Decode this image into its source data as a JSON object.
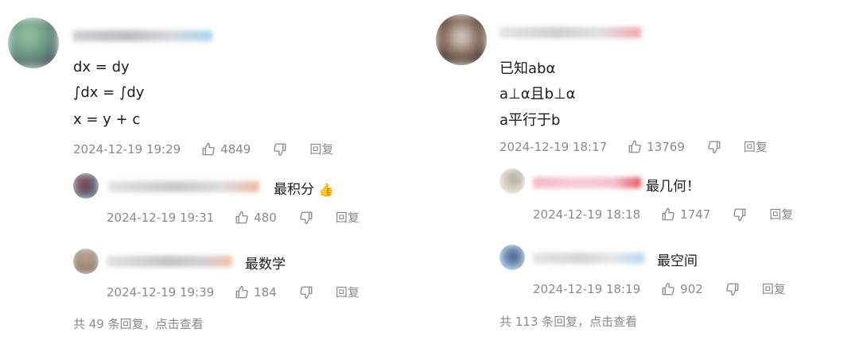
{
  "left": {
    "main": {
      "lines": [
        "dx = dy",
        "∫dx = ∫dy",
        "x = y + c"
      ],
      "timestamp": "2024-12-19 19:29",
      "likes": "4849",
      "reply_label": "回复"
    },
    "replies": [
      {
        "text": "最积分",
        "emoji": "👍",
        "timestamp": "2024-12-19 19:31",
        "likes": "480",
        "reply_label": "回复"
      },
      {
        "text": "最数学",
        "timestamp": "2024-12-19 19:39",
        "likes": "184",
        "reply_label": "回复"
      }
    ],
    "footer": "共 49 条回复，点击查看"
  },
  "right": {
    "main": {
      "lines": [
        "已知abα",
        "a⊥α且b⊥α",
        "a平行于b"
      ],
      "timestamp": "2024-12-19 18:17",
      "likes": "13769",
      "reply_label": "回复"
    },
    "replies": [
      {
        "text": "最几何！",
        "timestamp": "2024-12-19 18:18",
        "likes": "1747",
        "reply_label": "回复"
      },
      {
        "text": "最空间",
        "timestamp": "2024-12-19 18:19",
        "likes": "902",
        "reply_label": "回复"
      }
    ],
    "footer": "共 113 条回复，点击查看"
  },
  "icons": {
    "like": "thumbs-up-icon",
    "dislike": "thumbs-down-icon"
  },
  "colors": {
    "meta_text": "#8a8a8a",
    "body_text": "#1a1a1a"
  }
}
